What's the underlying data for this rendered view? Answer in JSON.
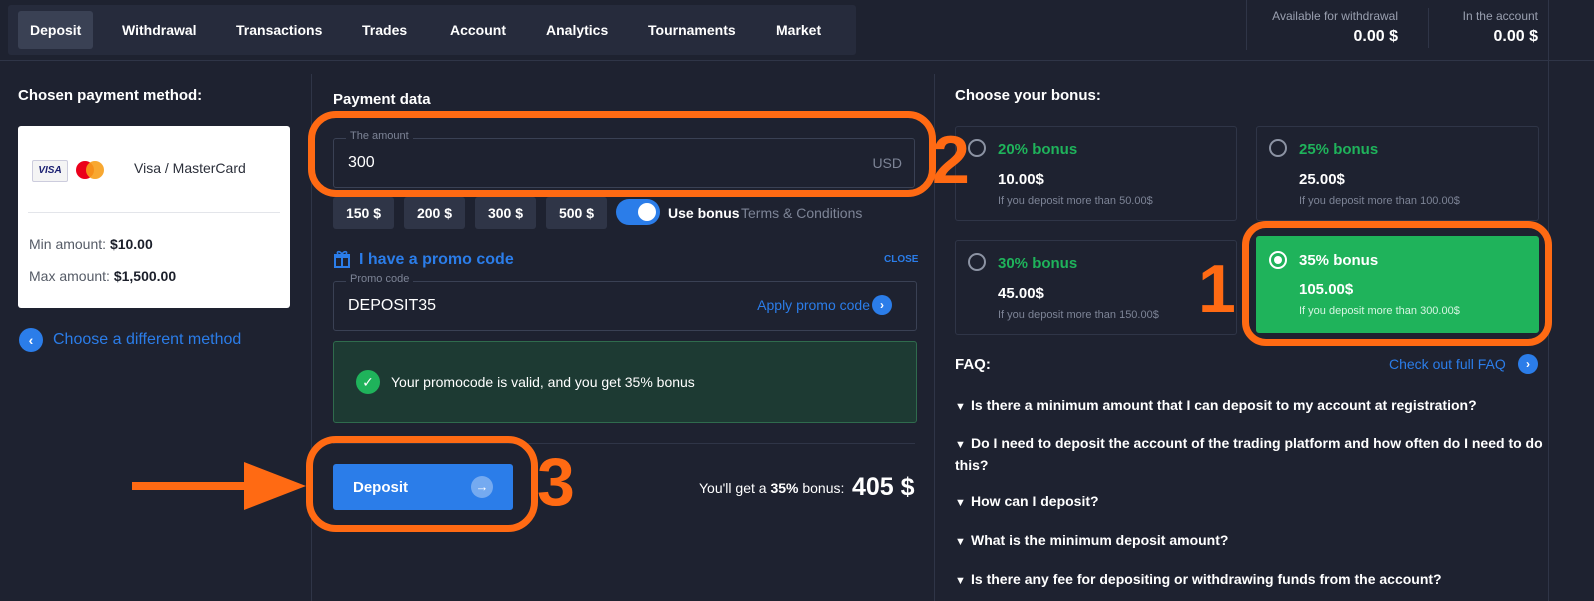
{
  "nav": {
    "tabs": [
      "Deposit",
      "Withdrawal",
      "Transactions",
      "Trades",
      "Account",
      "Analytics",
      "Tournaments",
      "Market"
    ],
    "active": "Deposit"
  },
  "balances": {
    "withdrawal_label": "Available for withdrawal",
    "withdrawal_value": "0.00 $",
    "account_label": "In the account",
    "account_value": "0.00 $"
  },
  "method": {
    "title": "Chosen payment method:",
    "visa_logo": "VISA",
    "name": "Visa / MasterCard",
    "min_label": "Min amount:",
    "min_value": "$10.00",
    "max_label": "Max amount:",
    "max_value": "$1,500.00",
    "change_link": "Choose a different method"
  },
  "payment": {
    "title": "Payment data",
    "amount_label": "The amount",
    "amount_value": "300",
    "currency": "USD",
    "quick_amounts": [
      "150 $",
      "200 $",
      "300 $",
      "500 $"
    ],
    "use_bonus_label": "Use bonus",
    "terms_label": "Terms & Conditions",
    "use_bonus_on": true
  },
  "promo": {
    "title": "I have a promo code",
    "close_label": "CLOSE",
    "code_label": "Promo code",
    "code_value": "DEPOSIT35",
    "apply_label": "Apply promo code",
    "valid_message": "Your promocode is valid, and you get 35% bonus"
  },
  "deposit": {
    "button_label": "Deposit",
    "summary_prefix": "You'll get a",
    "summary_percent": "35%",
    "summary_suffix": "bonus:",
    "total": "405 $"
  },
  "bonus": {
    "title": "Choose your bonus:",
    "options": [
      {
        "title": "20% bonus",
        "amount": "10.00$",
        "condition": "If you deposit more than 50.00$",
        "selected": false
      },
      {
        "title": "25% bonus",
        "amount": "25.00$",
        "condition": "If you deposit more than 100.00$",
        "selected": false
      },
      {
        "title": "30% bonus",
        "amount": "45.00$",
        "condition": "If you deposit more than 150.00$",
        "selected": false
      },
      {
        "title": "35% bonus",
        "amount": "105.00$",
        "condition": "If you deposit more than 300.00$",
        "selected": true
      }
    ]
  },
  "faq": {
    "title": "FAQ:",
    "full_link": "Check out full FAQ",
    "items": [
      "Is there a minimum amount that I can deposit to my account at registration?",
      "Do I need to deposit the account of the trading platform and how often do I need to do this?",
      "How can I deposit?",
      "What is the minimum deposit amount?",
      "Is there any fee for depositing or withdrawing funds from the account?"
    ]
  },
  "annotations": {
    "step1": "1",
    "step2": "2",
    "step3": "3",
    "color": "#ff6a13"
  },
  "colors": {
    "background": "#1e2230",
    "accent_blue": "#2b7de9",
    "bonus_green": "#1fb35b"
  }
}
